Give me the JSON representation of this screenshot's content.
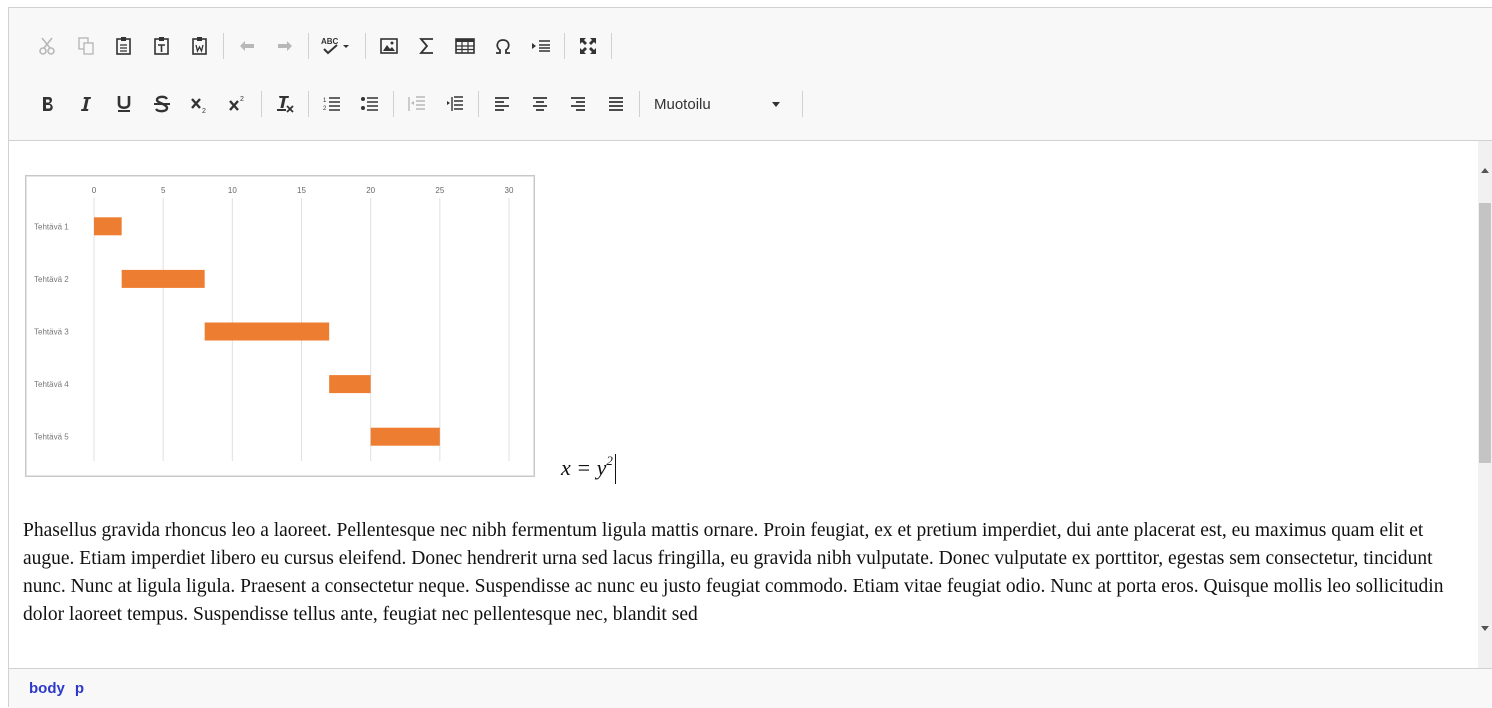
{
  "toolbar": {
    "row1": [
      {
        "name": "cut-icon",
        "title": "Leikkaa",
        "disabled": true
      },
      {
        "name": "copy-icon",
        "title": "Kopioi",
        "disabled": true
      },
      {
        "name": "paste-icon",
        "title": "Liitä",
        "disabled": false
      },
      {
        "name": "paste-text-icon",
        "title": "Liitä tekstinä",
        "disabled": false
      },
      {
        "name": "paste-word-icon",
        "title": "Liitä Wordista",
        "disabled": false
      },
      {
        "name": "undo-icon",
        "title": "Kumoa",
        "disabled": true
      },
      {
        "name": "redo-icon",
        "title": "Toista",
        "disabled": true
      },
      {
        "name": "spellcheck-icon",
        "title": "Oikoluku",
        "disabled": false
      },
      {
        "name": "image-icon",
        "title": "Kuva",
        "disabled": false
      },
      {
        "name": "math-icon",
        "title": "Kaava",
        "disabled": false
      },
      {
        "name": "table-icon",
        "title": "Taulukko",
        "disabled": false
      },
      {
        "name": "special-char-icon",
        "title": "Erikoismerkki",
        "disabled": false
      },
      {
        "name": "format-block-icon",
        "title": "Lohko",
        "disabled": false
      },
      {
        "name": "maximize-icon",
        "title": "Suurenna",
        "disabled": false
      }
    ],
    "format_label": "Muotoilu"
  },
  "content": {
    "math_base": "x = y",
    "math_exp": "2",
    "paragraph": "Phasellus gravida rhoncus leo a laoreet. Pellentesque nec nibh fermentum ligula mattis ornare. Proin feugiat, ex et pretium imperdiet, dui ante placerat est, eu maximus quam elit et augue. Etiam imperdiet libero eu cursus eleifend. Donec hendrerit urna sed lacus fringilla, eu gravida nibh vulputate. Donec vulputate ex porttitor, egestas sem consectetur, tincidunt nunc. Nunc at ligula ligula. Praesent a consectetur neque. Suspendisse ac nunc eu justo feugiat commodo. Etiam vitae feugiat odio. Nunc at porta eros. Quisque mollis leo sollicitudin dolor laoreet tempus. Suspendisse tellus ante, feugiat nec pellentesque nec, blandit sed"
  },
  "pathbar": {
    "items": [
      "body",
      "p"
    ]
  },
  "chart_data": {
    "type": "bar",
    "orientation": "horizontal-gantt",
    "categories": [
      "Tehtävä 1",
      "Tehtävä 2",
      "Tehtävä 3",
      "Tehtävä 4",
      "Tehtävä 5"
    ],
    "start": [
      0,
      2,
      8,
      17,
      20
    ],
    "duration": [
      2,
      6,
      9,
      3,
      5
    ],
    "xticks": [
      0,
      5,
      10,
      15,
      20,
      25,
      30
    ],
    "xlim": [
      0,
      30
    ],
    "grid": true,
    "bar_color": "#ed7d31",
    "title": "",
    "xlabel": "",
    "ylabel": ""
  }
}
